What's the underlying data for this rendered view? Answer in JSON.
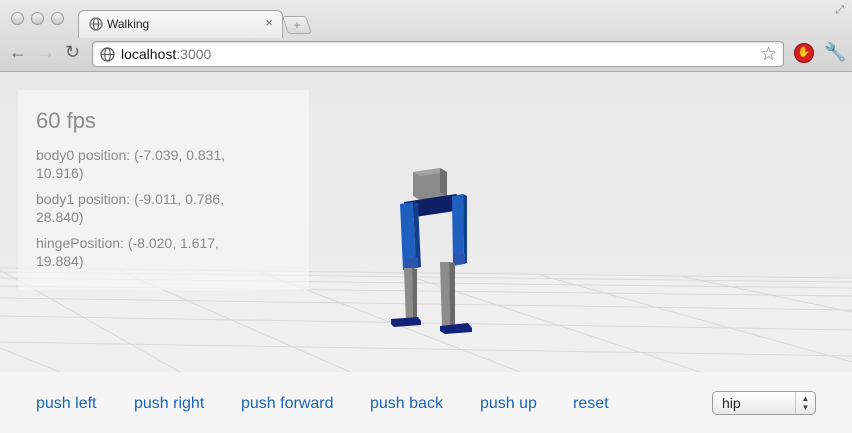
{
  "browser": {
    "tab_title": "Walking",
    "tab_close": "×",
    "url_host": "localhost",
    "url_port": ":3000",
    "new_tab": "+"
  },
  "stats": {
    "fps": "60 fps",
    "lines": [
      "body0 position: (-7.039, 0.831, 10.916)",
      "body1 position: (-9.011, 0.786, 28.840)",
      "hingePosition: (-8.020, 1.617, 19.884)"
    ]
  },
  "controls": {
    "buttons": [
      "push left",
      "push right",
      "push forward",
      "push back",
      "push up",
      "reset"
    ],
    "joint_select": {
      "value": "hip"
    }
  },
  "colors": {
    "link": "#1a64b4",
    "leg_blue": "#1f5fc0",
    "foot_navy": "#12247a",
    "shin_gray": "#888888"
  }
}
